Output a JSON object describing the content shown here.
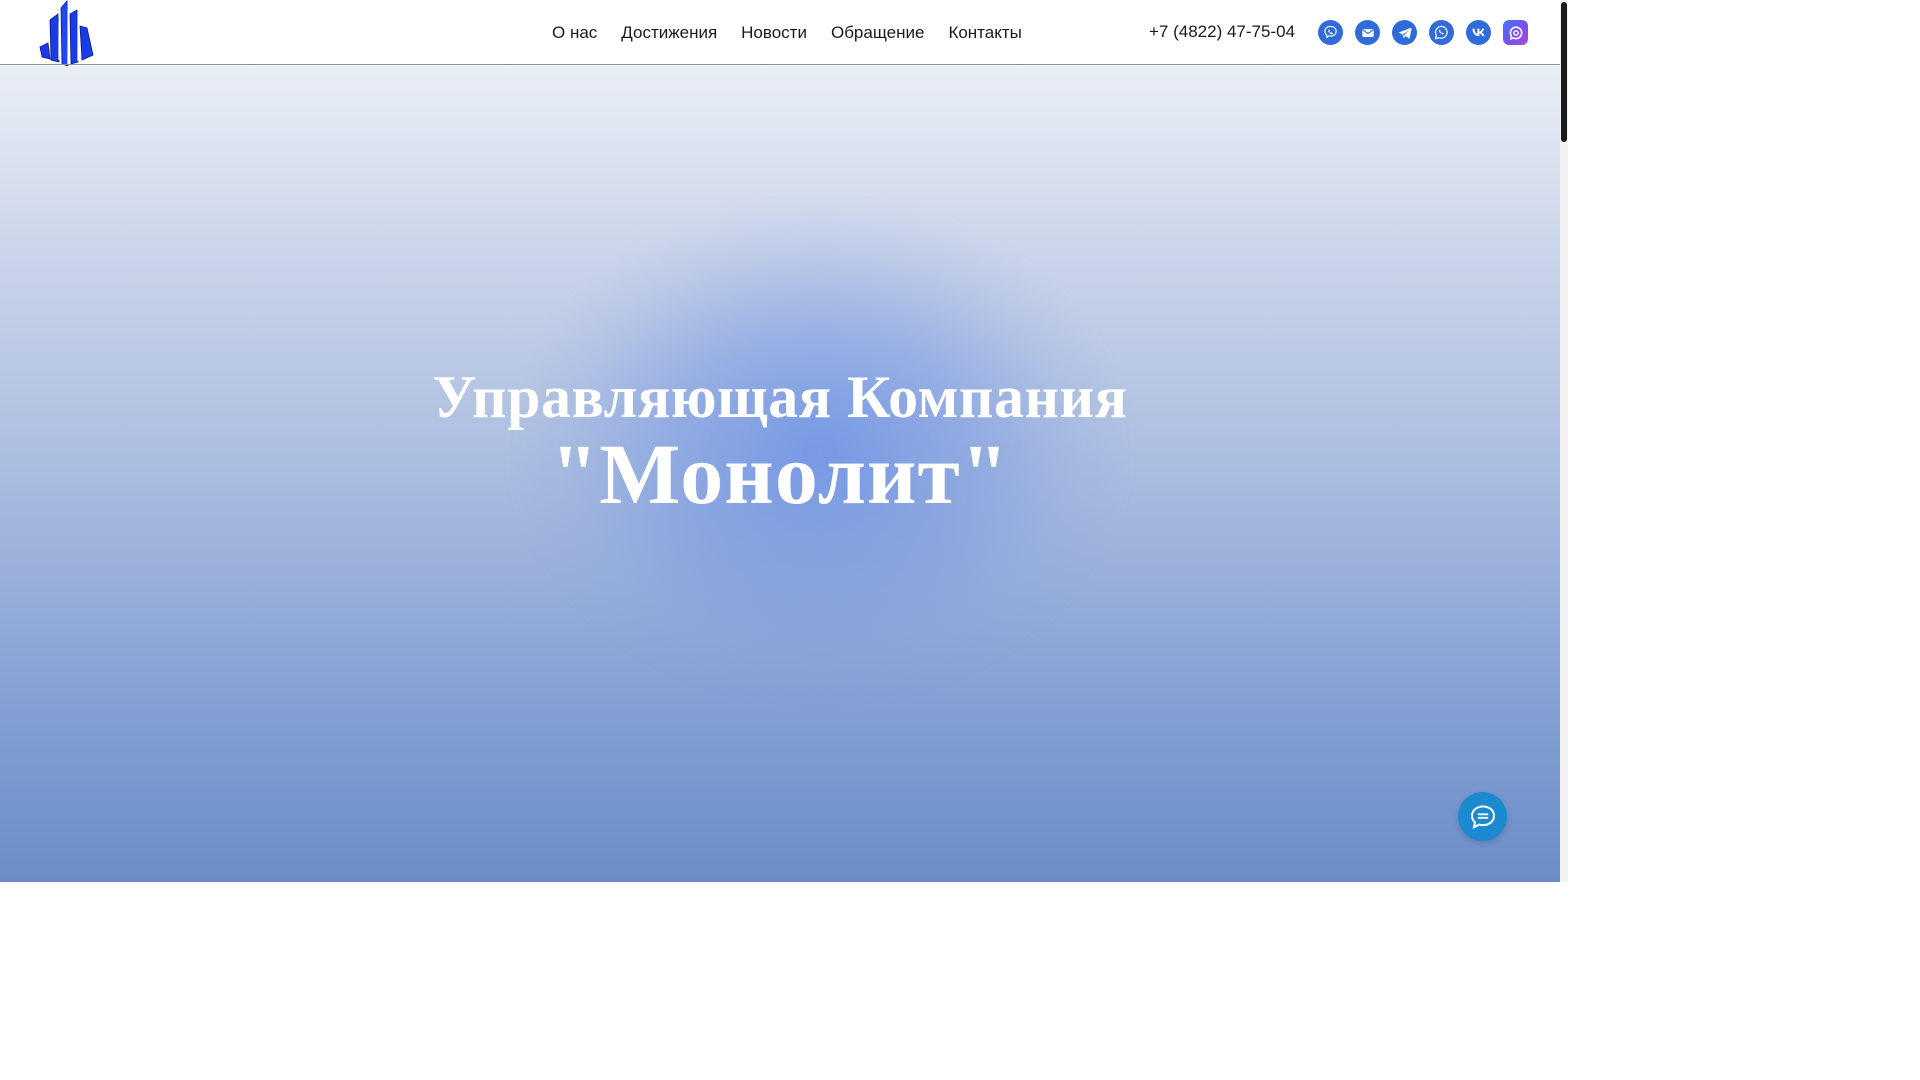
{
  "header": {
    "logo_icon": "building-columns-logo-icon",
    "nav": [
      {
        "label": "О нас"
      },
      {
        "label": "Достижения"
      },
      {
        "label": "Новости"
      },
      {
        "label": "Обращение"
      },
      {
        "label": "Контакты"
      }
    ],
    "phone": "+7 (4822) 47-75-04",
    "socials": [
      {
        "icon": "viber-icon",
        "color": "#2f6bd9"
      },
      {
        "icon": "mail-icon",
        "color": "#2f6bd9"
      },
      {
        "icon": "telegram-icon",
        "color": "#2f6bd9"
      },
      {
        "icon": "whatsapp-icon",
        "color": "#2f6bd9"
      },
      {
        "icon": "vk-icon",
        "color": "#2f6bd9"
      },
      {
        "icon": "max-messenger-icon",
        "color": "#6a4ff0"
      }
    ]
  },
  "hero": {
    "line1": "Управляющая Компания",
    "line2": "\"Монолит\""
  },
  "chat": {
    "icon": "chat-bubble-icon",
    "color": "#1b8ad0"
  }
}
